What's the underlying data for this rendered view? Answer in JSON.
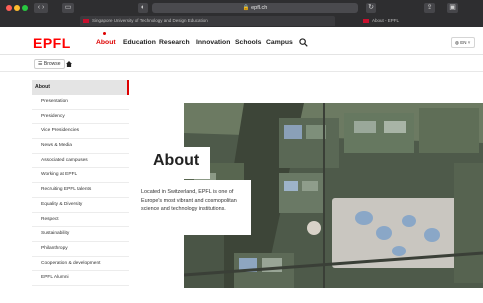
{
  "browser": {
    "url": "epfl.ch",
    "tabs": [
      {
        "label": "Singapore University of Technology and Design Education"
      },
      {
        "label": "About - EPFL"
      }
    ]
  },
  "header": {
    "logo": "EPFL",
    "nav": [
      "About",
      "Education",
      "Research",
      "Innovation",
      "Schools",
      "Campus"
    ],
    "language": "EN"
  },
  "breadcrumb": {
    "browse_label": "Browse"
  },
  "sidebar": {
    "heading": "About",
    "items": [
      {
        "label": "Presentation"
      },
      {
        "label": "Presidency"
      },
      {
        "label": "Vice Presidencies"
      },
      {
        "label": "News & Media"
      },
      {
        "label": "Associated campuses"
      },
      {
        "label": "Working at EPFL"
      },
      {
        "label": "Recruiting EPFL talents"
      },
      {
        "label": "Equality & Diversity"
      },
      {
        "label": "Respect"
      },
      {
        "label": "Sustainability"
      },
      {
        "label": "Philanthropy"
      },
      {
        "label": "Cooperation & development"
      },
      {
        "label": "EPFL Alumni"
      }
    ]
  },
  "hero": {
    "title": "About",
    "description": "Located in Switzerland, EPFL is one of Europe's most vibrant and cosmopolitan science and technology institutions."
  },
  "colors": {
    "brand_red": "#ff0000",
    "chrome_dark": "#2e2e30"
  }
}
